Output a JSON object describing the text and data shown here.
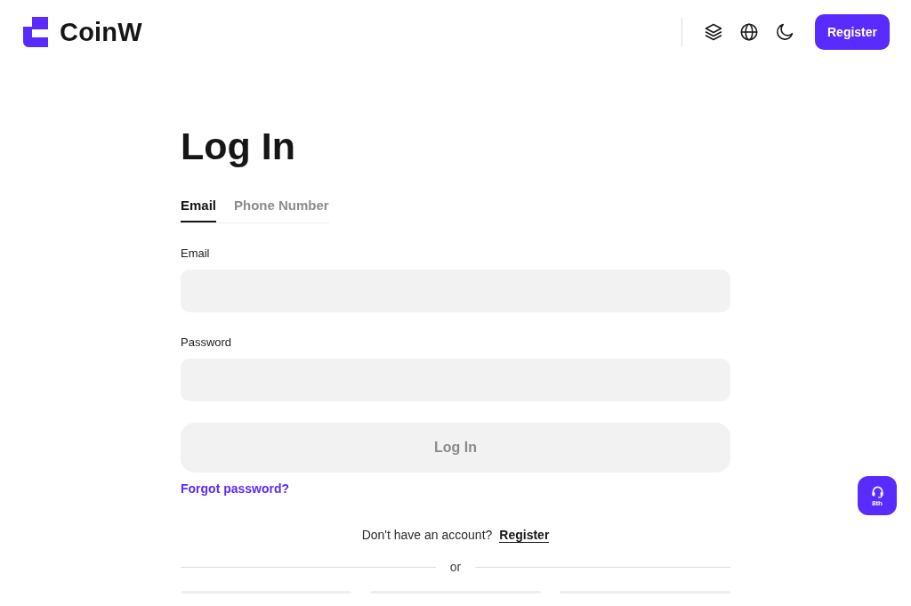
{
  "header": {
    "logo": "CoinW",
    "register_button": "Register"
  },
  "login": {
    "title": "Log In",
    "tabs": [
      {
        "label": "Email",
        "selected": true
      },
      {
        "label": "Phone Number",
        "selected": false
      }
    ],
    "fields": [
      {
        "label": "Email"
      },
      {
        "label": "Password"
      }
    ],
    "submit": {
      "label": "Log In",
      "disabled": true
    },
    "forgot_link": "Forgot password?",
    "signup_prompt": {
      "text": "Don't have an account?",
      "link": "Register"
    },
    "divider": "or"
  },
  "support_badge": {
    "label": "8th"
  }
}
